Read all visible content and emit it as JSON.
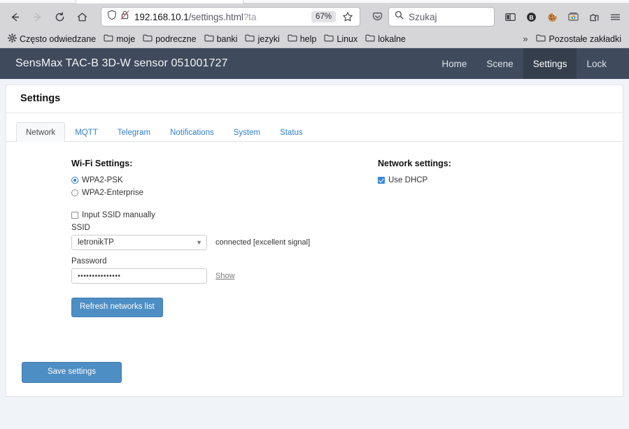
{
  "browser": {
    "nav": {
      "back": "back-arrow",
      "forward": "forward-arrow",
      "reload": "reload",
      "home": "home"
    },
    "urlbar": {
      "shield_icon": "shield-icon",
      "lock_icon": "lock-slashed-icon",
      "url_host": "192.168.10.1",
      "url_path": "/settings.html",
      "url_query": "?ta",
      "zoom_level": "67%",
      "bookmark_icon": "star-icon"
    },
    "pocket_icon": "pocket-icon",
    "search": {
      "icon": "search-icon",
      "placeholder": "Szukaj"
    },
    "toolbar_icons": [
      {
        "name": "sidebar-toggle-icon",
        "label": "sidebar"
      },
      {
        "name": "bitwarden-icon",
        "label": "B"
      },
      {
        "name": "cookie-icon",
        "label": "cookie"
      },
      {
        "name": "chrome-sync-icon",
        "label": "sync"
      },
      {
        "name": "extensions-icon",
        "label": "extensions"
      },
      {
        "name": "app-menu-icon",
        "label": "menu"
      }
    ],
    "bookmarks": [
      {
        "name": "bookmark-frequent",
        "icon": "gear-icon",
        "label": "Często odwiedzane"
      },
      {
        "name": "bookmark-moje",
        "icon": "folder-icon",
        "label": "moje"
      },
      {
        "name": "bookmark-podreczne",
        "icon": "folder-icon",
        "label": "podreczne"
      },
      {
        "name": "bookmark-banki",
        "icon": "folder-icon",
        "label": "banki"
      },
      {
        "name": "bookmark-jezyki",
        "icon": "folder-icon",
        "label": "jezyki"
      },
      {
        "name": "bookmark-help",
        "icon": "folder-icon",
        "label": "help"
      },
      {
        "name": "bookmark-linux",
        "icon": "folder-icon",
        "label": "Linux"
      },
      {
        "name": "bookmark-lokalne",
        "icon": "folder-icon",
        "label": "lokalne"
      }
    ],
    "bookmarks_overflow": "»",
    "other_bookmarks": {
      "icon": "folder-icon",
      "label": "Pozostałe zakładki"
    }
  },
  "app": {
    "title": "SensMax TAC-B 3D-W sensor 051001727",
    "header_bg": "#3f4b5c",
    "nav": [
      {
        "label": "Home",
        "active": false
      },
      {
        "label": "Scene",
        "active": false
      },
      {
        "label": "Settings",
        "active": true
      },
      {
        "label": "Lock",
        "active": false
      }
    ]
  },
  "panel": {
    "title": "Settings",
    "tabs": [
      {
        "label": "Network",
        "active": true
      },
      {
        "label": "MQTT",
        "active": false
      },
      {
        "label": "Telegram",
        "active": false
      },
      {
        "label": "Notifications",
        "active": false
      },
      {
        "label": "System",
        "active": false
      },
      {
        "label": "Status",
        "active": false
      }
    ]
  },
  "wifi": {
    "section_title": "Wi-Fi Settings:",
    "security_options": [
      {
        "label": "WPA2-PSK",
        "checked": true
      },
      {
        "label": "WPA2-Enterprise",
        "checked": false
      }
    ],
    "manual_ssid": {
      "label": "Input SSID manually",
      "checked": false
    },
    "ssid_label": "SSID",
    "ssid_value": "letronikTP",
    "ssid_status": "connected [excellent signal]",
    "password_label": "Password",
    "password_masked": "•••••••••••••••",
    "show_link": "Show",
    "refresh_button": "Refresh networks list"
  },
  "network": {
    "section_title": "Network settings:",
    "dhcp": {
      "label": "Use DHCP",
      "checked": true
    }
  },
  "footer": {
    "save_button": "Save settings"
  },
  "colors": {
    "accent_blue": "#4d8ec4",
    "link_blue": "#2f7fd0",
    "header_slate": "#3f4b5c",
    "page_bg": "#f0f3f8"
  }
}
